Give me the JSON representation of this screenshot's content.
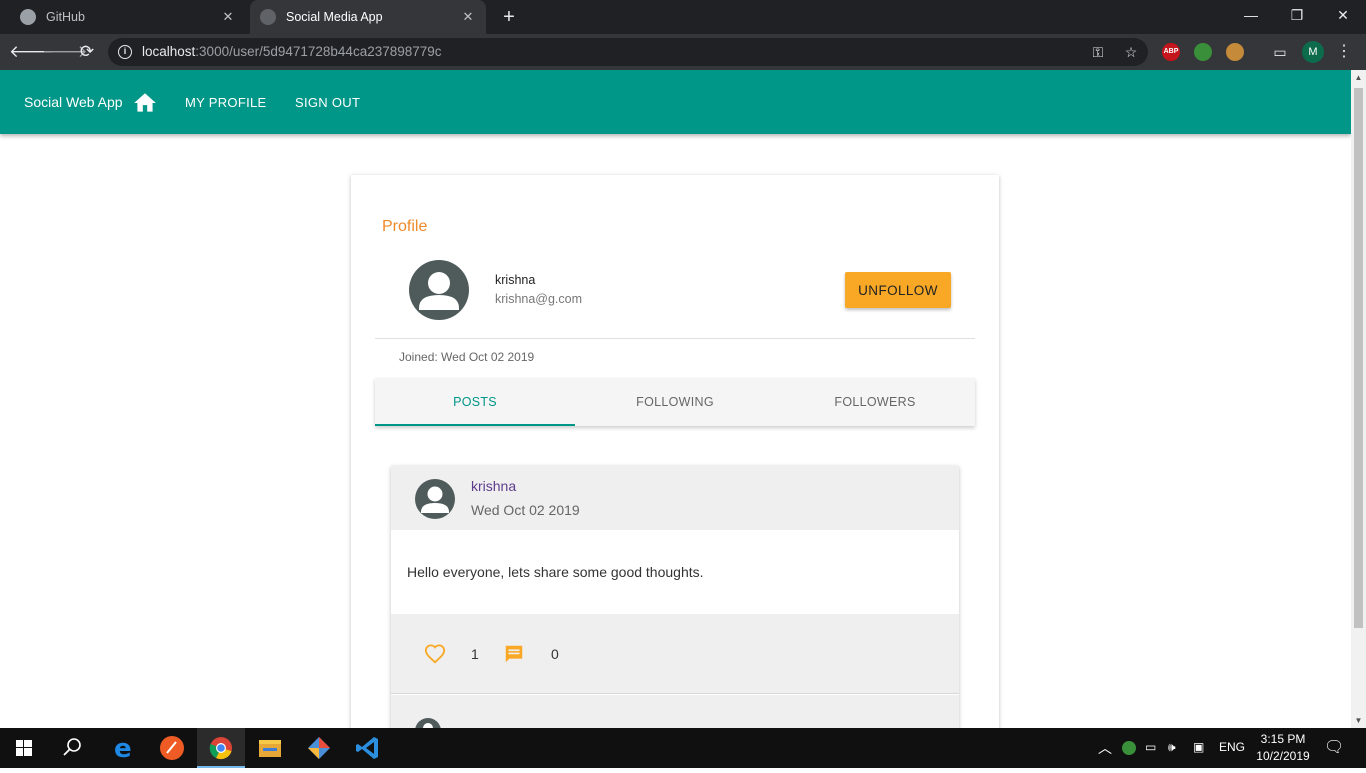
{
  "browser": {
    "tabs": [
      {
        "title": "GitHub",
        "active": false
      },
      {
        "title": "Social Media App",
        "active": true
      }
    ],
    "url_host": "localhost",
    "url_path": ":3000/user/5d9471728b44ca237898779c",
    "profile_initial": "M",
    "extension_abp": "ABP"
  },
  "app": {
    "brand": "Social Web App",
    "nav": {
      "my_profile": "MY PROFILE",
      "sign_out": "SIGN OUT"
    },
    "primary_color": "#009688",
    "accent_color": "#f9a825"
  },
  "profile": {
    "title": "Profile",
    "name": "krishna",
    "email": "krishna@g.com",
    "unfollow_label": "UNFOLLOW",
    "joined": "Joined: Wed Oct 02 2019",
    "tabs": [
      "POSTS",
      "FOLLOWING",
      "FOLLOWERS"
    ],
    "selected_tab": "POSTS"
  },
  "posts": [
    {
      "author": "krishna",
      "date": "Wed Oct 02 2019",
      "text": "Hello everyone, lets share some good thoughts.",
      "likes": "1",
      "comments": "0"
    }
  ],
  "taskbar": {
    "language": "ENG",
    "time": "3:15 PM",
    "date": "10/2/2019"
  }
}
